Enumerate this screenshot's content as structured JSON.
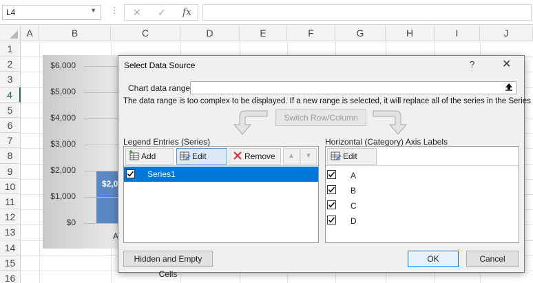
{
  "formula_bar": {
    "namebox": "L4",
    "dots": "⋮",
    "cancel_icon": "✕",
    "enter_icon": "✓",
    "fx": "fx",
    "formula": ""
  },
  "sheet": {
    "columns": [
      "A",
      "B",
      "C",
      "D",
      "E",
      "F",
      "G",
      "H",
      "I",
      "J"
    ],
    "rows": [
      "1",
      "2",
      "3",
      "4",
      "5",
      "6",
      "7",
      "8",
      "9",
      "10",
      "11",
      "12",
      "13",
      "14",
      "15",
      "16"
    ],
    "active_row": "4"
  },
  "chart": {
    "y_ticks": [
      "$6,000",
      "$5,000",
      "$4,000",
      "$3,000",
      "$2,000",
      "$1,000",
      "$0"
    ],
    "bar_label": "$2,0",
    "x_label": "A",
    "bar_color": "#5b87c3"
  },
  "dialog": {
    "title": "Select Data Source",
    "help": "?",
    "close": "✕",
    "chart_data_range_label": "Chart data range:",
    "range_value": "",
    "range_message": "The data range is too complex to be displayed. If a new range is selected, it will replace all of the series in the Series panel.",
    "switch_label": "Switch Row/Column",
    "legend_label": "Legend Entries (Series)",
    "axis_label": "Horizontal (Category) Axis Labels",
    "add_label": "Add",
    "edit_label": "Edit",
    "remove_label": "Remove",
    "series": [
      {
        "name": "Series1",
        "checked": true
      }
    ],
    "axis_edit_label": "Edit",
    "categories": [
      "A",
      "B",
      "C",
      "D"
    ],
    "hidden_cells_label": "Hidden and Empty Cells",
    "ok_label": "OK",
    "cancel_label": "Cancel",
    "selection_color": "#0078d7"
  }
}
